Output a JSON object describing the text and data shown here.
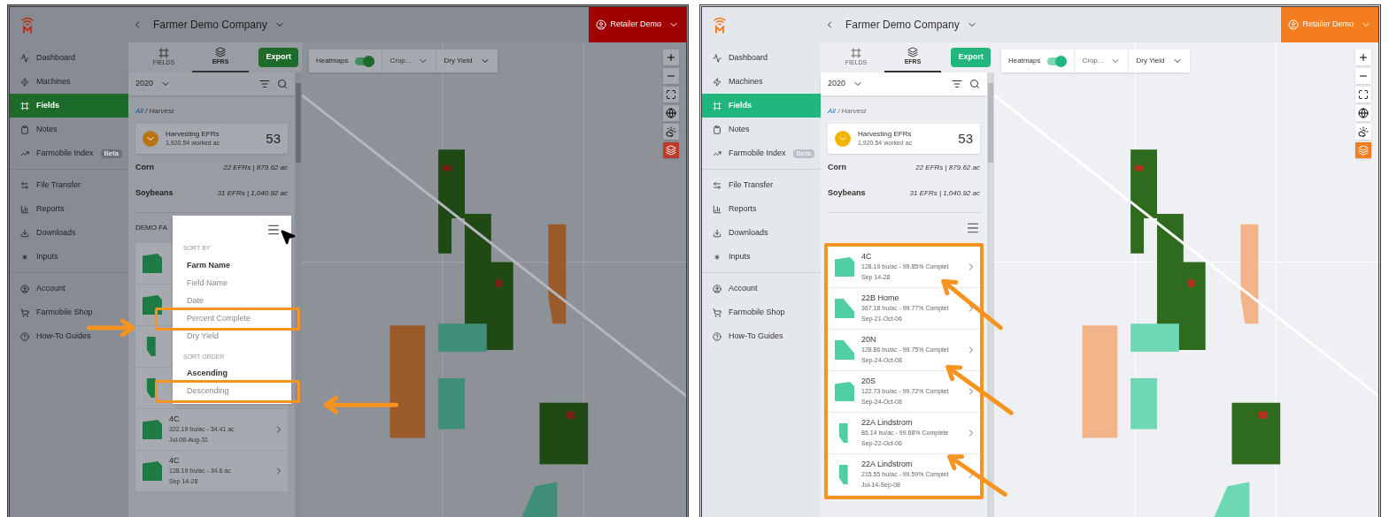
{
  "panels": [
    {
      "kind": "before",
      "dimmed": true,
      "company": "Farmer Demo Company",
      "user": "Retailer Demo",
      "nav_groups": [
        [
          {
            "label": "Dashboard",
            "selected": false
          },
          {
            "label": "Machines",
            "selected": false
          },
          {
            "label": "Fields",
            "selected": true
          },
          {
            "label": "Notes",
            "selected": false
          },
          {
            "label": "Farmobile Index",
            "badge": "Beta",
            "selected": false
          }
        ],
        [
          {
            "label": "File Transfer",
            "selected": false
          },
          {
            "label": "Reports",
            "selected": false
          },
          {
            "label": "Downloads",
            "selected": false
          },
          {
            "label": "Inputs",
            "selected": false
          }
        ],
        [
          {
            "label": "Account",
            "selected": false
          },
          {
            "label": "Farmobile Shop",
            "selected": false
          },
          {
            "label": "How-To Guides",
            "selected": false
          }
        ]
      ],
      "tabs": [
        {
          "label": "FIELDS",
          "selected": false
        },
        {
          "label": "EFRS",
          "selected": true
        }
      ],
      "export": "Export",
      "year": "2020",
      "breadcrumb": {
        "link": "All",
        "rest": "/ Harvest"
      },
      "summary": {
        "title": "Harvesting EFRs",
        "subtitle": "1,920.54 worked ac",
        "count": "53"
      },
      "crops": [
        {
          "name": "Corn",
          "detail": "22 EFRs | 879.62 ac"
        },
        {
          "name": "Soybeans",
          "detail": "31 EFRs | 1,040.92 ac"
        }
      ],
      "section_label": "DEMO FA",
      "list_highlighted": false,
      "items": [
        {
          "kind": "block"
        },
        {
          "kind": "block"
        },
        {
          "kind": "strip"
        },
        {
          "kind": "strip"
        },
        {
          "kind": "block",
          "name": "4C",
          "detail": "322.19 bu/ac - 34.41 ac",
          "dates": "Jul-06-Aug-31"
        },
        {
          "kind": "block",
          "name": "4C",
          "detail": "128.19 bu/ac - 34.6 ac",
          "dates": "Sep 14-28"
        }
      ],
      "sort_menu": {
        "sections": [
          {
            "title": "SORT BY",
            "options": [
              {
                "label": "Farm Name",
                "selected": true,
                "highlighted": false
              },
              {
                "label": "Field Name",
                "selected": false,
                "highlighted": false
              },
              {
                "label": "Date",
                "selected": false,
                "highlighted": false
              },
              {
                "label": "Percent Complete",
                "selected": false,
                "highlighted": true
              },
              {
                "label": "Dry Yield",
                "selected": false,
                "highlighted": false
              }
            ]
          },
          {
            "title": "SORT ORDER",
            "options": [
              {
                "label": "Ascending",
                "selected": true,
                "highlighted": false
              },
              {
                "label": "Descending",
                "selected": false,
                "highlighted": true
              }
            ]
          }
        ]
      },
      "map": {
        "heatmaps_label": "Heatmaps",
        "heatmaps_on": true,
        "crop": "Crop...",
        "layer": "Dry Yield"
      }
    },
    {
      "kind": "after",
      "dimmed": false,
      "company": "Farmer Demo Company",
      "user": "Retailer Demo",
      "nav_groups": [
        [
          {
            "label": "Dashboard",
            "selected": false
          },
          {
            "label": "Machines",
            "selected": false
          },
          {
            "label": "Fields",
            "selected": true
          },
          {
            "label": "Notes",
            "selected": false
          },
          {
            "label": "Farmobile Index",
            "badge": "Beta",
            "selected": false
          }
        ],
        [
          {
            "label": "File Transfer",
            "selected": false
          },
          {
            "label": "Reports",
            "selected": false
          },
          {
            "label": "Downloads",
            "selected": false
          },
          {
            "label": "Inputs",
            "selected": false
          }
        ],
        [
          {
            "label": "Account",
            "selected": false
          },
          {
            "label": "Farmobile Shop",
            "selected": false
          },
          {
            "label": "How-To Guides",
            "selected": false
          }
        ]
      ],
      "tabs": [
        {
          "label": "FIELDS",
          "selected": false
        },
        {
          "label": "EFRS",
          "selected": true
        }
      ],
      "export": "Export",
      "year": "2020",
      "breadcrumb": {
        "link": "All",
        "rest": "/ Harvest"
      },
      "summary": {
        "title": "Harvesting EFRs",
        "subtitle": "1,920.54 worked ac",
        "count": "53"
      },
      "crops": [
        {
          "name": "Corn",
          "detail": "22 EFRs | 879.62 ac"
        },
        {
          "name": "Soybeans",
          "detail": "31 EFRs | 1,040.92 ac"
        }
      ],
      "list_highlighted": true,
      "items": [
        {
          "kind": "block",
          "name": "4C",
          "detail": "128.19 bu/ac - 99.85% Complet",
          "dates": "Sep 14-28"
        },
        {
          "kind": "wedge",
          "name": "22B Home",
          "detail": "367.18 bu/ac - 99.77% Complet",
          "dates": "Sep-21-Oct-06"
        },
        {
          "kind": "wedge",
          "name": "20N",
          "detail": "128.86 bu/ac - 99.75% Complet",
          "dates": "Sep-24-Oct-08"
        },
        {
          "kind": "block",
          "name": "20S",
          "detail": "122.73 bu/ac - 99.72% Complet",
          "dates": "Sep-24-Oct-08"
        },
        {
          "kind": "strip",
          "name": "22A Lindstrom",
          "detail": "86.14 bu/ac - 99.68% Complete",
          "dates": "Sep-22-Oct-06"
        },
        {
          "kind": "strip",
          "name": "22A Lindstrom",
          "detail": "215.55 bu/ac - 99.59% Complet",
          "dates": "Jul-14-Sep-08"
        }
      ],
      "map": {
        "heatmaps_label": "Heatmaps",
        "heatmaps_on": true,
        "crop": "Crop...",
        "layer": "Dry Yield"
      }
    }
  ]
}
